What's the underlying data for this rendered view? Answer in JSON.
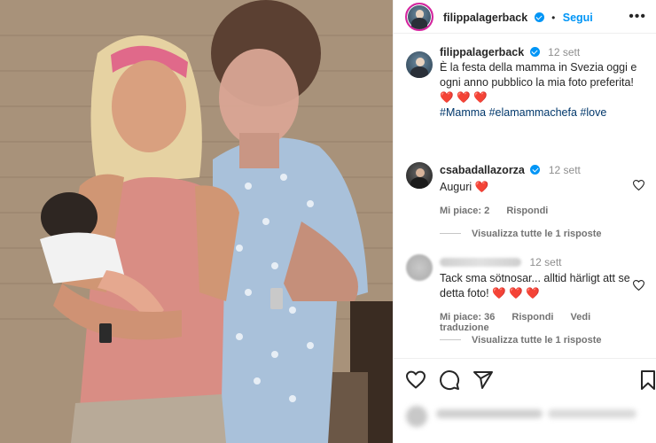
{
  "post": {
    "username": "filippalagerback",
    "follow_label": "Segui",
    "separator": "•",
    "more_label": "•••",
    "timestamp": "12 sett",
    "caption": "È la festa della mamma in Svezia oggi e ogni anno pubblico la mia foto preferita!",
    "caption_hearts": "❤️ ❤️ ❤️",
    "hashtags": "#Mamma #elamammachefa #love"
  },
  "comments": [
    {
      "username": "csabadallazorza",
      "timestamp": "12 sett",
      "text": "Auguri",
      "heart": "❤️",
      "likes": "Mi piace: 2",
      "reply_label": "Rispondi",
      "view_replies": "Visualizza tutte le 1 risposte"
    },
    {
      "timestamp": "12 sett",
      "text": "Tack sma sötnosar... alltid härligt att se detta foto!",
      "hearts": "❤️ ❤️ ❤️",
      "likes": "Mi piace: 36",
      "reply_label": "Rispondi",
      "translate_label": "Vedi traduzione",
      "view_replies": "Visualizza tutte le 1 risposte"
    }
  ],
  "icons": {
    "like": "heart-icon",
    "comment": "comment-icon",
    "share": "paper-plane-icon",
    "save": "bookmark-icon"
  },
  "colors": {
    "accent": "#0095f6",
    "hashtag": "#00376b",
    "heart": "#ed1c3b",
    "secondary_text": "#737373"
  }
}
